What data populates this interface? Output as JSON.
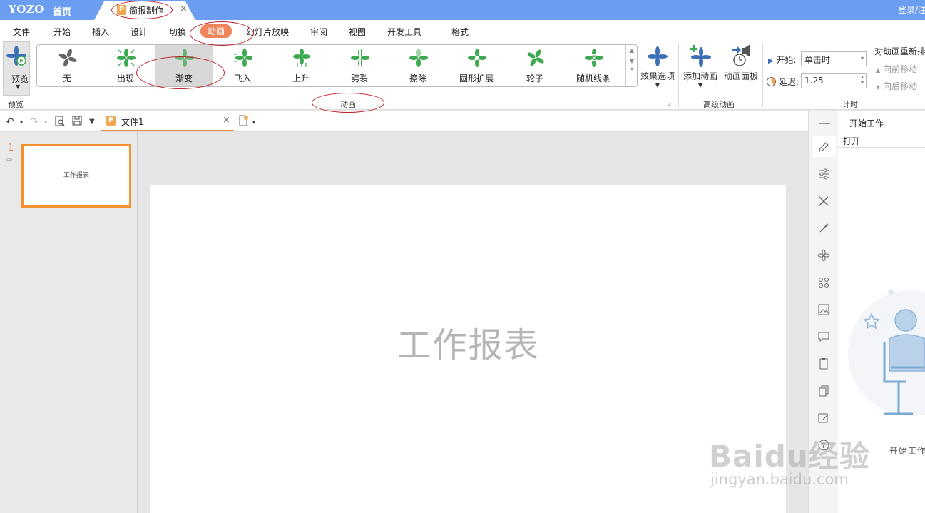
{
  "titlebar": {
    "logo": "YOZO",
    "home_tab": "首页",
    "doc_tab": {
      "icon_letter": "P",
      "label": "简报制作",
      "close": "×"
    },
    "login": "登录/注"
  },
  "menu": [
    "文件",
    "开始",
    "插入",
    "设计",
    "切换",
    "动画",
    "幻灯片放映",
    "审阅",
    "视图",
    "开发工具",
    "格式"
  ],
  "menu_active": "动画",
  "ribbon": {
    "preview": {
      "label": "预览",
      "group": "预览"
    },
    "animations": [
      "无",
      "出现",
      "渐变",
      "飞入",
      "上升",
      "劈裂",
      "擦除",
      "圆形扩展",
      "轮子",
      "随机线条"
    ],
    "selected_animation": "渐变",
    "animation_group_label": "动画",
    "effect_options": "效果选项",
    "add_animation": "添加动画",
    "animation_pane": "动画面板",
    "advanced_group": "高级动画",
    "timing": {
      "start_label": "开始:",
      "start_value": "单击时",
      "delay_label": "延迟:",
      "delay_value": "1.25",
      "group": "计时"
    },
    "reorder": {
      "title": "对动画重新排",
      "move_earlier": "向前移动",
      "move_later": "向后移动"
    }
  },
  "quickbar": {
    "file_tab": {
      "icon_letter": "P",
      "label": "文件1",
      "close": "×"
    }
  },
  "slides_panel": {
    "slide_number": "1",
    "thumb_title": "工作报表"
  },
  "slide": {
    "title": "工作报表"
  },
  "task_pane": {
    "title": "开始工作",
    "open": "打开",
    "start_text": "开始工作"
  },
  "watermark": {
    "brand": "Baidu经验",
    "url": "jingyan.baidu.com"
  },
  "colors": {
    "titlebar": "#6b9df0",
    "accent": "#f0845a",
    "thumb_border": "#f5922e",
    "annotation": "#c0202c",
    "icon_green": "#3daa52",
    "icon_blue": "#3b6fb6"
  }
}
